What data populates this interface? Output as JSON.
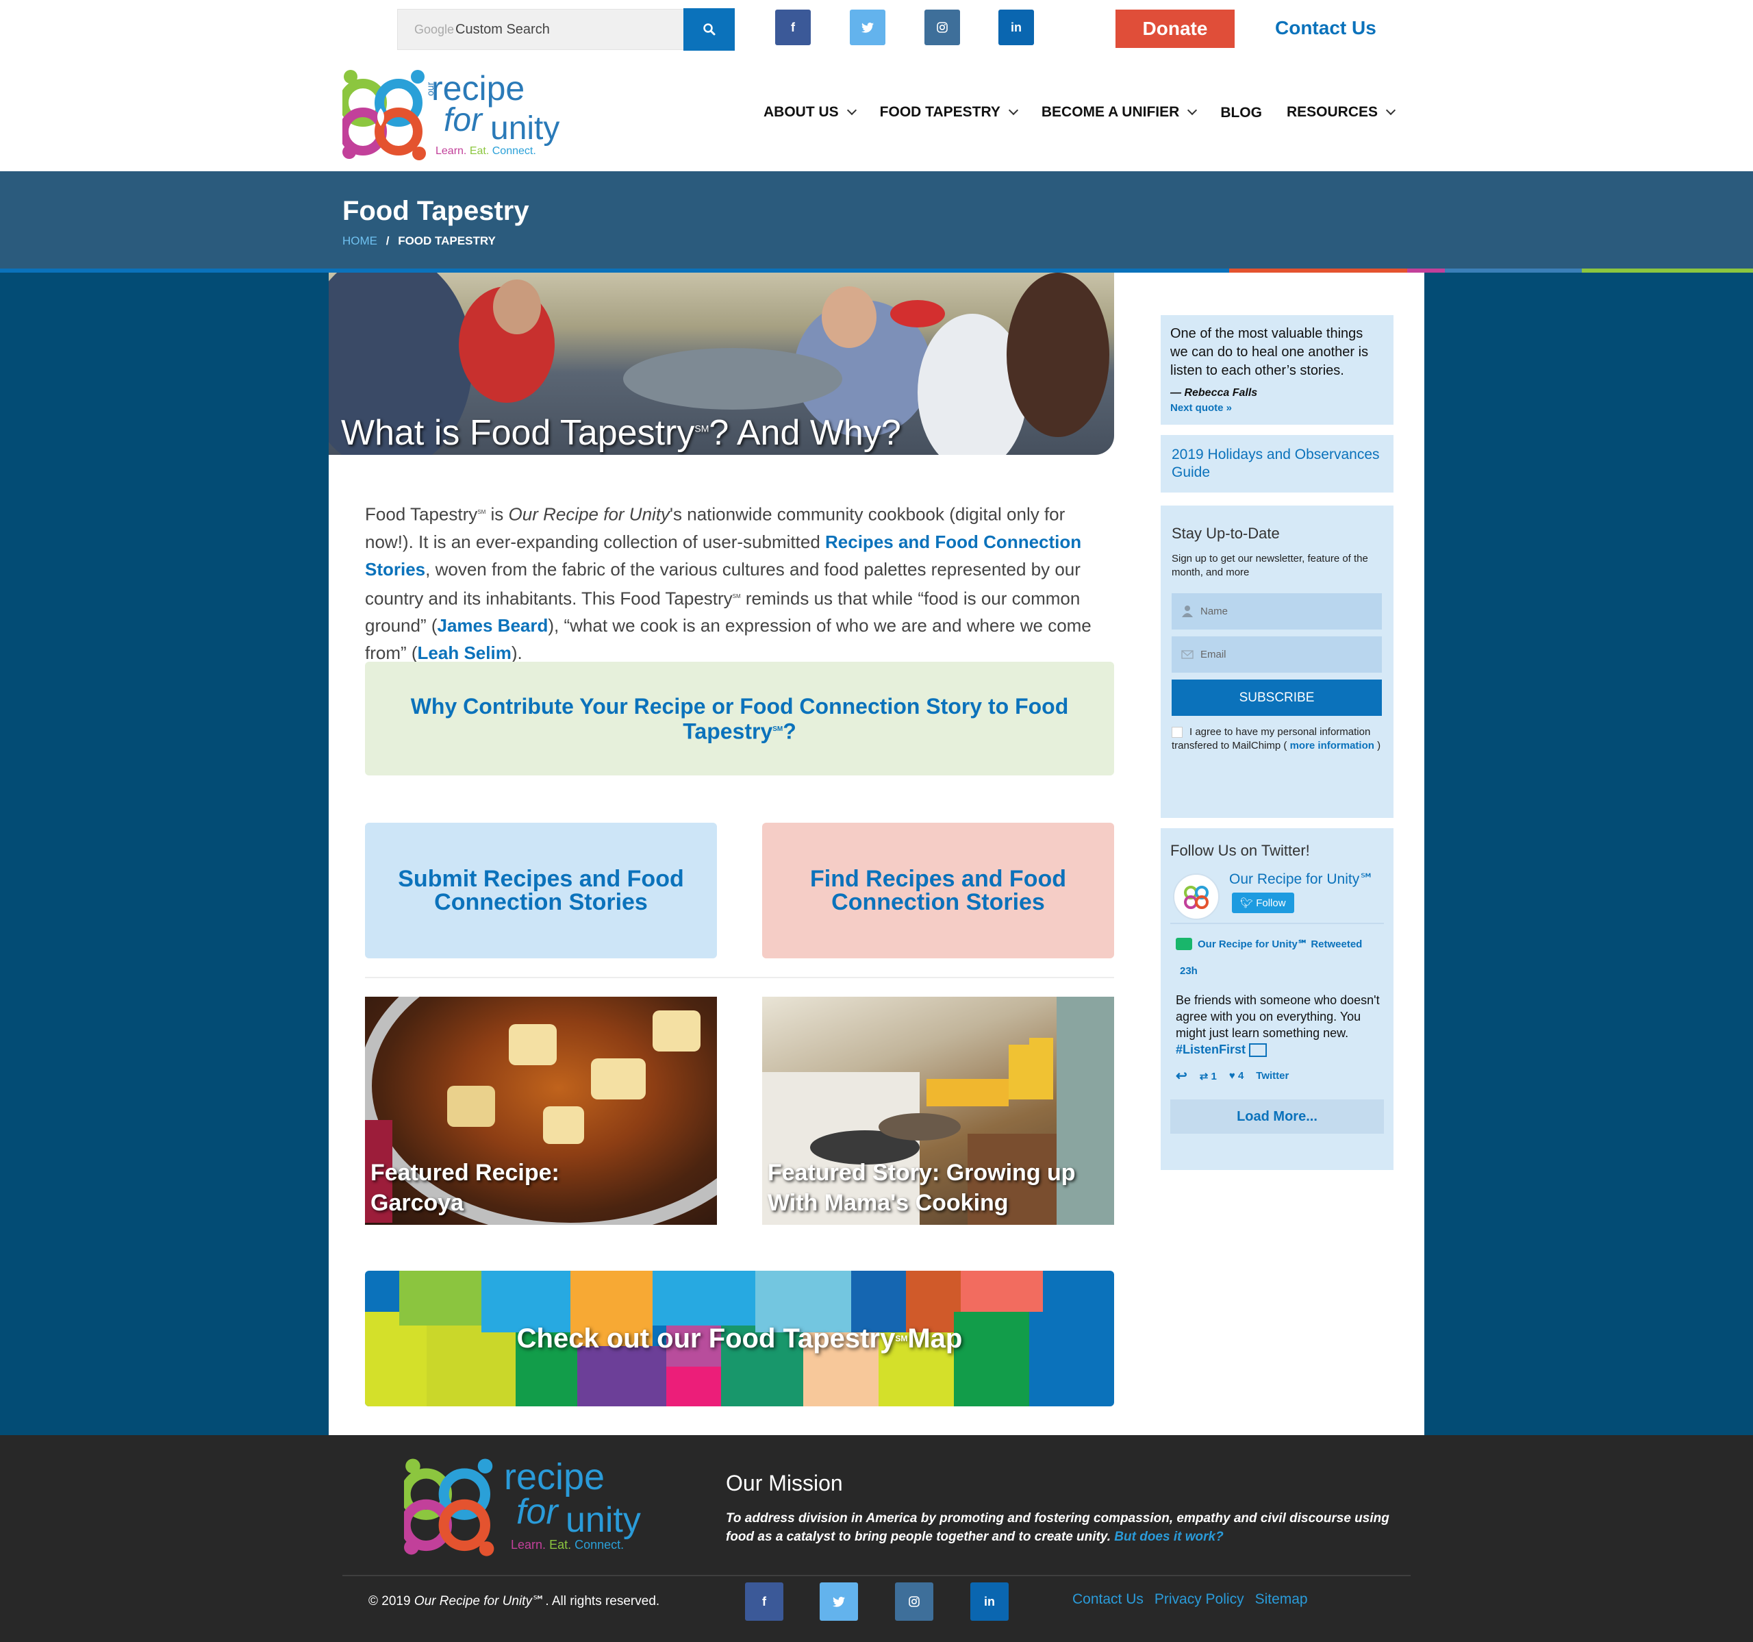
{
  "search": {
    "google_label": "Google",
    "placeholder": "Custom Search"
  },
  "top": {
    "donate_label": "Donate",
    "contact_label": "Contact Us"
  },
  "logo": {
    "our": "our",
    "recipe": "recipe",
    "for": "for",
    "unity": "unity",
    "tag_learn": "Learn.",
    "tag_eat": "Eat.",
    "tag_connect": "Connect."
  },
  "nav": [
    {
      "label": "ABOUT US",
      "has_dropdown": true
    },
    {
      "label": "FOOD TAPESTRY",
      "has_dropdown": true
    },
    {
      "label": "BECOME A UNIFIER",
      "has_dropdown": true
    },
    {
      "label": "BLOG",
      "has_dropdown": false
    },
    {
      "label": "RESOURCES",
      "has_dropdown": true
    }
  ],
  "page": {
    "title": "Food Tapestry",
    "breadcrumb_home": "HOME",
    "breadcrumb_sep": "/",
    "breadcrumb_current": "FOOD TAPESTRY"
  },
  "hero": {
    "title_a": "What is Food Tapestry",
    "title_sm": "SM",
    "title_b": "? And Why?"
  },
  "intro": {
    "t1": "Food Tapestry",
    "t1_sm": "SM",
    "t2": " is ",
    "t2_em": "Our Recipe for Unity",
    "t3": "'s nationwide community cookbook (digital only for now!). It is an ever-expanding collection of user-submitted ",
    "link1": "Recipes and Food Connection Stories",
    "t4": ", woven from the fabric of the various cultures and food palettes represented by our country and its inhabitants. This Food Tapestry",
    "t4_sm": "SM",
    "t5": " reminds us that while “food is our common ground” (",
    "link2": "James Beard",
    "t6": "), “what we cook is an expression of who we are and where we come from” (",
    "link3": "Leah Selim",
    "t7": ")."
  },
  "why_box": {
    "label_a": "Why Contribute Your Recipe or Food Connection Story to Food Tapestry",
    "label_sm": "SM",
    "label_b": "?"
  },
  "cta": {
    "submit_label": "Submit Recipes and Food Connection Stories",
    "find_label": "Find Recipes and Food Connection Stories"
  },
  "features": {
    "recipe_caption": "Featured Recipe: Garcoya",
    "story_caption": "Featured Story: Growing up With Mama's Cooking"
  },
  "map_banner": {
    "label_a": "Check out our Food Tapestry",
    "label_sm": "SM",
    "label_b": " Map"
  },
  "sidebar": {
    "quote": {
      "text": "One of the most valuable things we can do to heal one another is listen to each other’s stories.",
      "author": "— Rebecca Falls",
      "next": "Next quote »"
    },
    "holidays_link": "2019 Holidays and Observances Guide",
    "newsletter": {
      "title": "Stay Up-to-Date",
      "desc": "Sign up to get our newsletter, feature of the month, and more",
      "name_placeholder": "Name",
      "email_placeholder": "Email",
      "subscribe_label": "SUBSCRIBE",
      "agree_text": "I agree to have my personal information transfered to MailChimp (",
      "agree_link": "more information",
      "agree_close": ")"
    },
    "twitter": {
      "title": "Follow Us on Twitter!",
      "account": "Our Recipe for Unity℠",
      "follow": "Follow",
      "retweeted": "Our Recipe for Unity℠ Retweeted",
      "time": "23h",
      "tweet_text": "Be friends with someone who doesn't agree with you on everything. You might just learn something new. ",
      "tweet_hashtag": "#ListenFirst",
      "retweet_count": "1",
      "like_count": "4",
      "source": "Twitter",
      "load_more": "Load More..."
    }
  },
  "footer": {
    "mission_title": "Our Mission",
    "mission_text": "To address division in America by promoting and fostering compassion, empathy and civil discourse using food as a catalyst to bring people together and to create unity. ",
    "mission_link": "But does it work?",
    "copyright_a": "© 2019 ",
    "copyright_em": "Our Recipe for Unity",
    "copyright_b": "℠. All rights reserved.",
    "links": [
      "Contact Us",
      "Privacy Policy",
      "Sitemap"
    ]
  },
  "colors": {
    "brand_blue": "#0b72bb",
    "donate_red": "#e04e39",
    "title_band": "#2b5b7d",
    "main_bg": "#034c75",
    "footer_bg": "#282828",
    "facebook": "#3b5998",
    "twitter": "#63b3ed",
    "instagram": "#3e6f9a",
    "linkedin": "#0a66b0"
  },
  "icons": [
    "search-icon",
    "facebook-icon",
    "twitter-icon",
    "instagram-icon",
    "linkedin-icon",
    "chevron-down-icon",
    "user-icon",
    "mail-icon",
    "retweet-icon",
    "reply-icon",
    "heart-icon",
    "image-icon"
  ]
}
